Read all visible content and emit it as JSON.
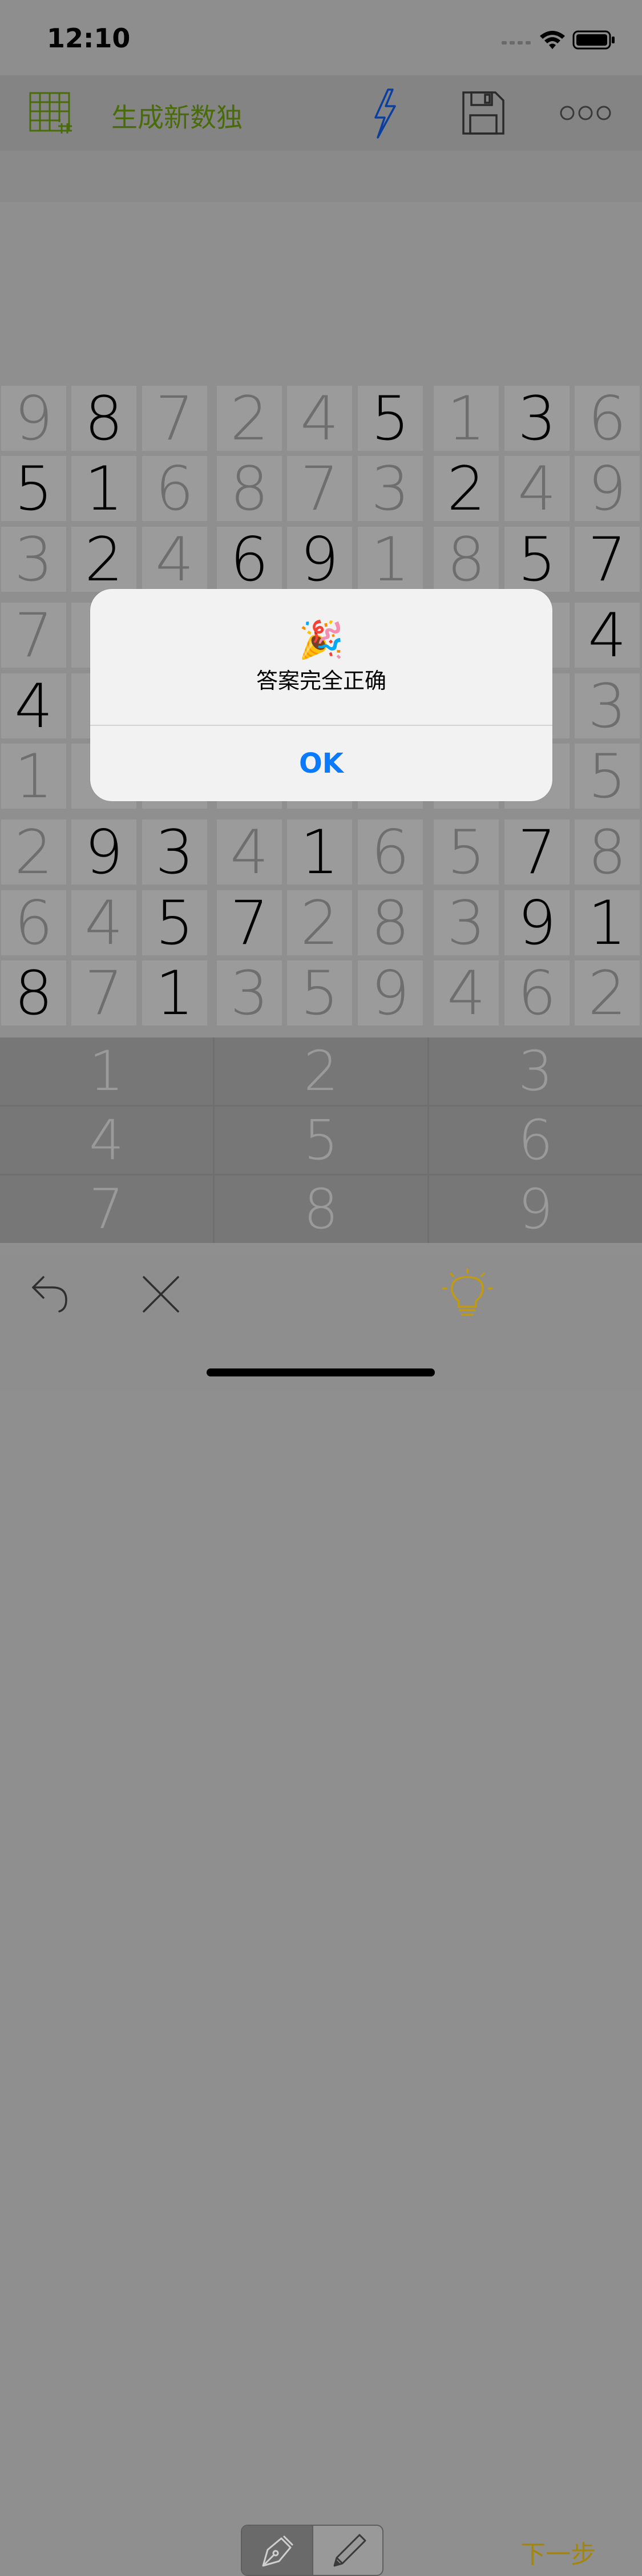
{
  "status_bar": {
    "time": "12:10"
  },
  "toolbar": {
    "title": "生成新数独"
  },
  "grid": {
    "rows": [
      [
        {
          "v": "9",
          "given": false
        },
        {
          "v": "8",
          "given": true
        },
        {
          "v": "7",
          "given": false
        },
        {
          "v": "2",
          "given": false
        },
        {
          "v": "4",
          "given": false
        },
        {
          "v": "5",
          "given": true
        },
        {
          "v": "1",
          "given": false
        },
        {
          "v": "3",
          "given": true
        },
        {
          "v": "6",
          "given": false
        }
      ],
      [
        {
          "v": "5",
          "given": true
        },
        {
          "v": "1",
          "given": true
        },
        {
          "v": "6",
          "given": false
        },
        {
          "v": "8",
          "given": false
        },
        {
          "v": "7",
          "given": false
        },
        {
          "v": "3",
          "given": false
        },
        {
          "v": "2",
          "given": true
        },
        {
          "v": "4",
          "given": false
        },
        {
          "v": "9",
          "given": false
        }
      ],
      [
        {
          "v": "3",
          "given": false
        },
        {
          "v": "2",
          "given": true
        },
        {
          "v": "4",
          "given": false
        },
        {
          "v": "6",
          "given": true
        },
        {
          "v": "9",
          "given": true
        },
        {
          "v": "1",
          "given": false
        },
        {
          "v": "8",
          "given": false
        },
        {
          "v": "5",
          "given": true
        },
        {
          "v": "7",
          "given": true
        }
      ],
      [
        {
          "v": "7",
          "given": false
        },
        {
          "v": "",
          "given": false
        },
        {
          "v": "",
          "given": false
        },
        {
          "v": "",
          "given": false
        },
        {
          "v": "",
          "given": false
        },
        {
          "v": "",
          "given": false
        },
        {
          "v": "",
          "given": false
        },
        {
          "v": "",
          "given": false
        },
        {
          "v": "4",
          "given": true
        }
      ],
      [
        {
          "v": "4",
          "given": true
        },
        {
          "v": "",
          "given": false
        },
        {
          "v": "",
          "given": false
        },
        {
          "v": "",
          "given": false
        },
        {
          "v": "",
          "given": false
        },
        {
          "v": "",
          "given": false
        },
        {
          "v": "",
          "given": false
        },
        {
          "v": "",
          "given": false
        },
        {
          "v": "3",
          "given": false
        }
      ],
      [
        {
          "v": "1",
          "given": false
        },
        {
          "v": "",
          "given": false
        },
        {
          "v": "",
          "given": false
        },
        {
          "v": "",
          "given": false
        },
        {
          "v": "",
          "given": false
        },
        {
          "v": "",
          "given": false
        },
        {
          "v": "",
          "given": false
        },
        {
          "v": "",
          "given": false
        },
        {
          "v": "5",
          "given": false
        }
      ],
      [
        {
          "v": "2",
          "given": false
        },
        {
          "v": "9",
          "given": true
        },
        {
          "v": "3",
          "given": true
        },
        {
          "v": "4",
          "given": false
        },
        {
          "v": "1",
          "given": true
        },
        {
          "v": "6",
          "given": false
        },
        {
          "v": "5",
          "given": false
        },
        {
          "v": "7",
          "given": true
        },
        {
          "v": "8",
          "given": false
        }
      ],
      [
        {
          "v": "6",
          "given": false
        },
        {
          "v": "4",
          "given": false
        },
        {
          "v": "5",
          "given": true
        },
        {
          "v": "7",
          "given": true
        },
        {
          "v": "2",
          "given": false
        },
        {
          "v": "8",
          "given": false
        },
        {
          "v": "3",
          "given": false
        },
        {
          "v": "9",
          "given": true
        },
        {
          "v": "1",
          "given": true
        }
      ],
      [
        {
          "v": "8",
          "given": true
        },
        {
          "v": "7",
          "given": false
        },
        {
          "v": "1",
          "given": true
        },
        {
          "v": "3",
          "given": false
        },
        {
          "v": "5",
          "given": false
        },
        {
          "v": "9",
          "given": false
        },
        {
          "v": "4",
          "given": false
        },
        {
          "v": "6",
          "given": false
        },
        {
          "v": "2",
          "given": false
        }
      ]
    ]
  },
  "keypad": {
    "keys": [
      "1",
      "2",
      "3",
      "4",
      "5",
      "6",
      "7",
      "8",
      "9"
    ]
  },
  "bottom_bar": {
    "next_step": "下一步"
  },
  "alert": {
    "emoji": "🎉",
    "message": "答案完全正确",
    "ok_label": "OK"
  }
}
